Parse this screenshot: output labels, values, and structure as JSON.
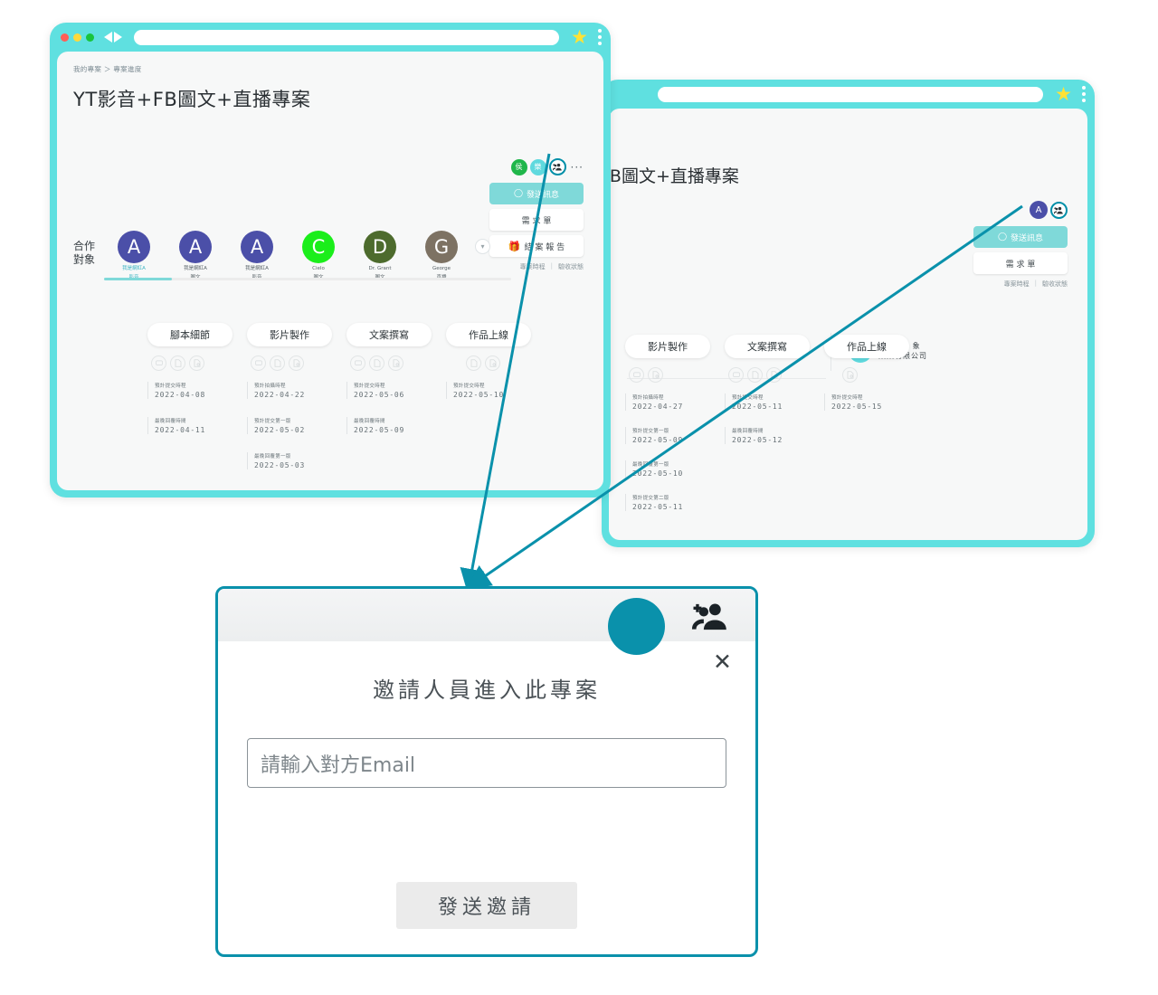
{
  "window1": {
    "browser": {
      "star_icon": "star-icon",
      "menu_icon": "kebab-menu-icon"
    },
    "breadcrumb": "我的專案 ＞ 專案進度",
    "project_title": "YT影音+FB圖文+直播專案",
    "header_avatars": [
      {
        "initial": "侯",
        "color": "#1fb64a"
      },
      {
        "initial": "樂",
        "color": "#5fd9de"
      }
    ],
    "add_people_icon": "add-people-icon",
    "more_menu": "···",
    "actions": [
      {
        "label": "發送訊息",
        "style": "primary",
        "icon": "chat-icon"
      },
      {
        "label": "需 求 單",
        "style": "plain",
        "icon": ""
      },
      {
        "label": "結 案 報 告",
        "style": "plain",
        "icon": "gift-icon"
      }
    ],
    "sub_links": [
      "專案時程",
      "驗收狀態"
    ],
    "collab_label": "合作\n對象",
    "collab_label_line1": "合作",
    "collab_label_line2": "對象",
    "collaborators": [
      {
        "initial": "A",
        "color": "#4b4fa8",
        "name": "我是網紅A",
        "role": "影音",
        "active": true
      },
      {
        "initial": "A",
        "color": "#4b4fa8",
        "name": "我是網紅A",
        "role": "圖文",
        "active": false
      },
      {
        "initial": "A",
        "color": "#4b4fa8",
        "name": "我是網紅A",
        "role": "影音",
        "active": false
      },
      {
        "initial": "C",
        "color": "#1bee1b",
        "name": "Cielo",
        "role": "圖文",
        "active": false
      },
      {
        "initial": "D",
        "color": "#4d6b2d",
        "name": "Dr. Grant",
        "role": "圖文",
        "active": false
      },
      {
        "initial": "G",
        "color": "#7d7263",
        "name": "George",
        "role": "直播",
        "active": false
      }
    ],
    "expand_icon": "chevron-down-icon",
    "stages": [
      {
        "name": "腳本細節",
        "icons": [
          "chat-bubble-icon",
          "document-edit-icon",
          "document-search-icon"
        ],
        "dates": [
          {
            "label": "預計提交時程",
            "value": "2022-04-08"
          },
          {
            "label": "最晚回覆時間",
            "value": "2022-04-11"
          }
        ]
      },
      {
        "name": "影片製作",
        "icons": [
          "chat-bubble-icon",
          "document-edit-icon",
          "document-search-icon"
        ],
        "dates": [
          {
            "label": "預計拍攝時程",
            "value": "2022-04-22"
          },
          {
            "label": "預計提交第一版",
            "value": "2022-05-02"
          },
          {
            "label": "最晚回覆第一版",
            "value": "2022-05-03"
          }
        ]
      },
      {
        "name": "文案撰寫",
        "icons": [
          "chat-bubble-icon",
          "document-edit-icon",
          "document-search-icon"
        ],
        "dates": [
          {
            "label": "預計提交時程",
            "value": "2022-05-06"
          },
          {
            "label": "最晚回覆時間",
            "value": "2022-05-09"
          }
        ]
      },
      {
        "name": "作品上線",
        "icons": [
          "document-edit-icon",
          "document-search-icon"
        ],
        "dates": [
          {
            "label": "預計提交時程",
            "value": "2022-05-10"
          }
        ]
      }
    ]
  },
  "window2": {
    "project_title": "FB圖文+直播專案",
    "header_avatar": {
      "initial": "A",
      "color": "#4b4fa8"
    },
    "add_people_icon": "add-people-icon",
    "partner": {
      "avatar_initial": "樂",
      "avatar_color": "#5fd9de",
      "label": "合 作 對 象",
      "name": "樂樂有限公司"
    },
    "actions": [
      {
        "label": "發送訊息",
        "style": "primary",
        "icon": "chat-icon"
      },
      {
        "label": "需 求 單",
        "style": "plain",
        "icon": ""
      }
    ],
    "sub_links": [
      "專案時程",
      "驗收狀態"
    ],
    "stages": [
      {
        "name": "影片製作",
        "icons": [
          "chat-bubble-icon",
          "document-search-icon"
        ],
        "dates": [
          {
            "label": "預計拍攝時程",
            "value": "2022-04-27"
          },
          {
            "label": "預計提交第一版",
            "value": "2022-05-09"
          },
          {
            "label": "最晚回覆第一版",
            "value": "2022-05-10"
          },
          {
            "label": "預計提交第二版",
            "value": "2022-05-11"
          }
        ]
      },
      {
        "name": "文案撰寫",
        "icons": [
          "chat-bubble-icon",
          "document-edit-icon",
          "document-search-icon"
        ],
        "dates": [
          {
            "label": "預計提交時程",
            "value": "2022-05-11"
          },
          {
            "label": "最晚回覆時間",
            "value": "2022-05-12"
          }
        ]
      },
      {
        "name": "作品上線",
        "icons": [
          "document-search-icon"
        ],
        "dates": [
          {
            "label": "預計提交時程",
            "value": "2022-05-15"
          }
        ]
      }
    ]
  },
  "modal": {
    "title": "邀請人員進入此專案",
    "input_placeholder": "請輸入對方Email",
    "input_value": "",
    "submit_label": "發送邀請",
    "close_icon": "close-icon",
    "add_people_icon": "add-people-icon"
  },
  "theme": {
    "accent": "#0a91ab",
    "browser_frame": "#5fe0e0",
    "primary_button": "#7fd9d9"
  }
}
